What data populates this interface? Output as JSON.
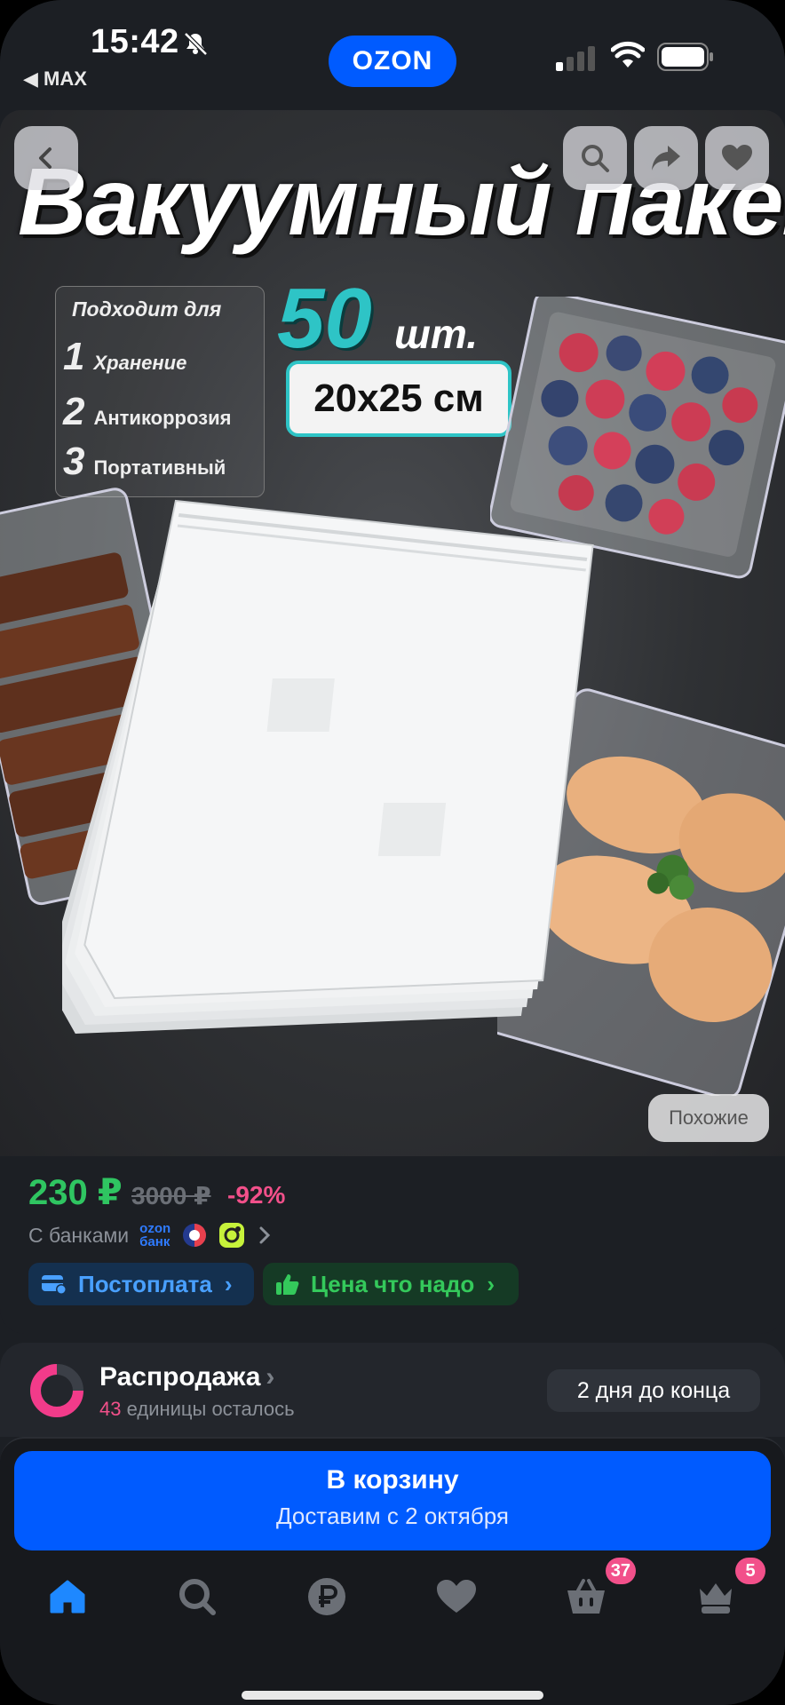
{
  "status": {
    "time": "15:42",
    "back_app": "◀ MAX",
    "brand": "OZON"
  },
  "product_image": {
    "title": "Вакуумный пакет",
    "fits_heading": "Подходит для",
    "uses": [
      {
        "num": "1",
        "label": "Хранение"
      },
      {
        "num": "2",
        "label": "Антикоррозия"
      },
      {
        "num": "3",
        "label": "Портативный"
      }
    ],
    "quantity": "50",
    "quantity_unit": "шт.",
    "size": "20x25 см",
    "similar_label": "Похожие"
  },
  "price": {
    "current": "230 ₽",
    "old": "3000 ₽",
    "discount": "-92%",
    "banks_label": "С банками",
    "ozon_bank": "ozon\nбанк",
    "chips": {
      "postpay": "Постоплата",
      "good_price": "Цена что надо"
    }
  },
  "sale": {
    "title": "Распродажа",
    "units_left": "43",
    "units_label": "единицы осталось",
    "deadline": "2 дня до конца"
  },
  "cart": {
    "label": "В корзину",
    "delivery": "Доставим с 2 октября"
  },
  "tabs": [
    {
      "name": "home",
      "active": true
    },
    {
      "name": "search"
    },
    {
      "name": "payments"
    },
    {
      "name": "favorites"
    },
    {
      "name": "cart",
      "badge": "37"
    },
    {
      "name": "profile",
      "badge": "5"
    }
  ],
  "colors": {
    "accent": "#005bff",
    "price": "#2fc561",
    "discount": "#f2508a",
    "active_tab": "#1e88ff"
  }
}
